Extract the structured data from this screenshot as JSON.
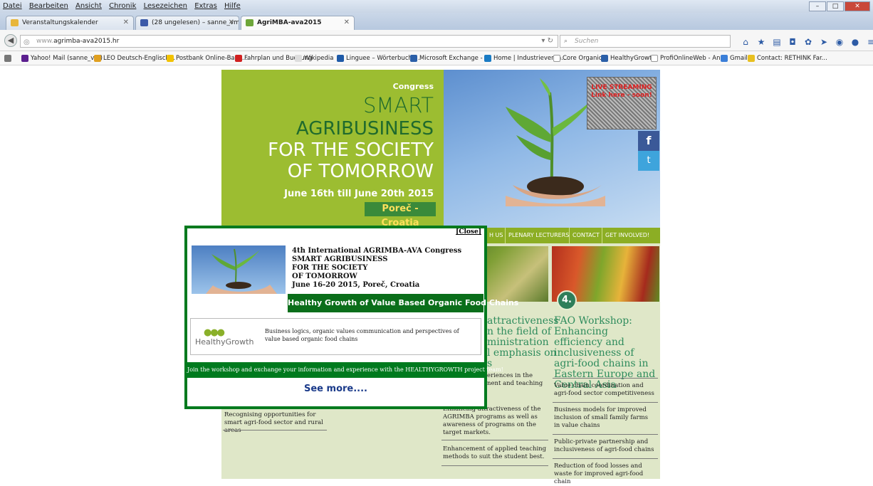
{
  "browser": {
    "menu": [
      "Datei",
      "Bearbeiten",
      "Ansicht",
      "Chronik",
      "Lesezeichen",
      "Extras",
      "Hilfe"
    ],
    "tabs": [
      {
        "label": "Veranstaltungskalender"
      },
      {
        "label": "(28 ungelesen) – sanne_vm – Yaho..."
      },
      {
        "label": "AgriMBA-ava2015"
      }
    ],
    "new_tab": "+",
    "url_prefix": "www.",
    "url_main": "agrimba-ava2015.hr",
    "search_placeholder": "Suchen",
    "bookmarks": [
      "Yahoo! Mail (sanne_vm)",
      "LEO Deutsch-Englisch...",
      "Postbank Online-Bank...",
      "Fahrplan und Buchung",
      "Wikipedia",
      "Linguee – Wörterbuch ...",
      "Microsoft Exchange - ...",
      "Home | Industrieverba...",
      "Core Organic 2",
      "HealthyGrowth",
      "ProfiOnlineWeb - An...",
      "Gmail",
      "Contact: RETHINK Far..."
    ]
  },
  "banner": {
    "congress": "Congress",
    "smart": "SMART",
    "agribusiness": "AGRIBUSINESS",
    "society": "FOR THE SOCIETY",
    "tomorrow": "OF TOMORROW",
    "dates": "June 16th till June 20th 2015",
    "place": "Poreč - Croatia",
    "live": "LIVE STREAMING Link here - soon!",
    "facebook": "f",
    "twitter": "t"
  },
  "nav": [
    "H US",
    "PLENARY LECTURERS",
    "CONTACT",
    "GET INVOLVED!"
  ],
  "column_mid": {
    "heading_lines": [
      "attractiveness",
      "n the field of",
      "ministration",
      "l emphasis on",
      "s"
    ],
    "items": [
      "eriences in the",
      "nent and teaching",
      "Enhancing attractiveness of the AGRIMBA programs as well as awareness of programs on the target markets.",
      "Enhancement of applied teaching methods to suit the student best."
    ]
  },
  "column_left": {
    "items": [
      "Recognising opportunities for smart agri-food sector and rural areas"
    ]
  },
  "column_right": {
    "badge": "4.",
    "heading": "FAO Workshop: Enhancing efficiency and inclusiveness of agri-food chains in Eastern Europe and Central Asia",
    "items": [
      "Value chain coordination and agri-food sector competitiveness",
      "Business models for improved inclusion of small family farms in value chains",
      "Public-private partnership and inclusiveness of agri-food chains",
      "Reduction of food losses and waste for improved agri-food chain"
    ]
  },
  "popup": {
    "close": "[Close]",
    "title_lines": [
      "4th International AGRIMBA-AVA Congress",
      "SMART AGRIBUSINESS",
      "FOR THE SOCIETY",
      "OF TOMORROW",
      "June 16-20 2015, Poreč, Croatia"
    ],
    "bar": "Healthy Growth of Value Based Organic Food Chains",
    "logo_text": "HealthyGrowth",
    "description": "Business logics, organic values communication and perspectives of value based organic food chains",
    "join": "Join the workshop and exchange your information and experience with the HEALTHYGROWTH project team!",
    "see_more": "See more...."
  }
}
